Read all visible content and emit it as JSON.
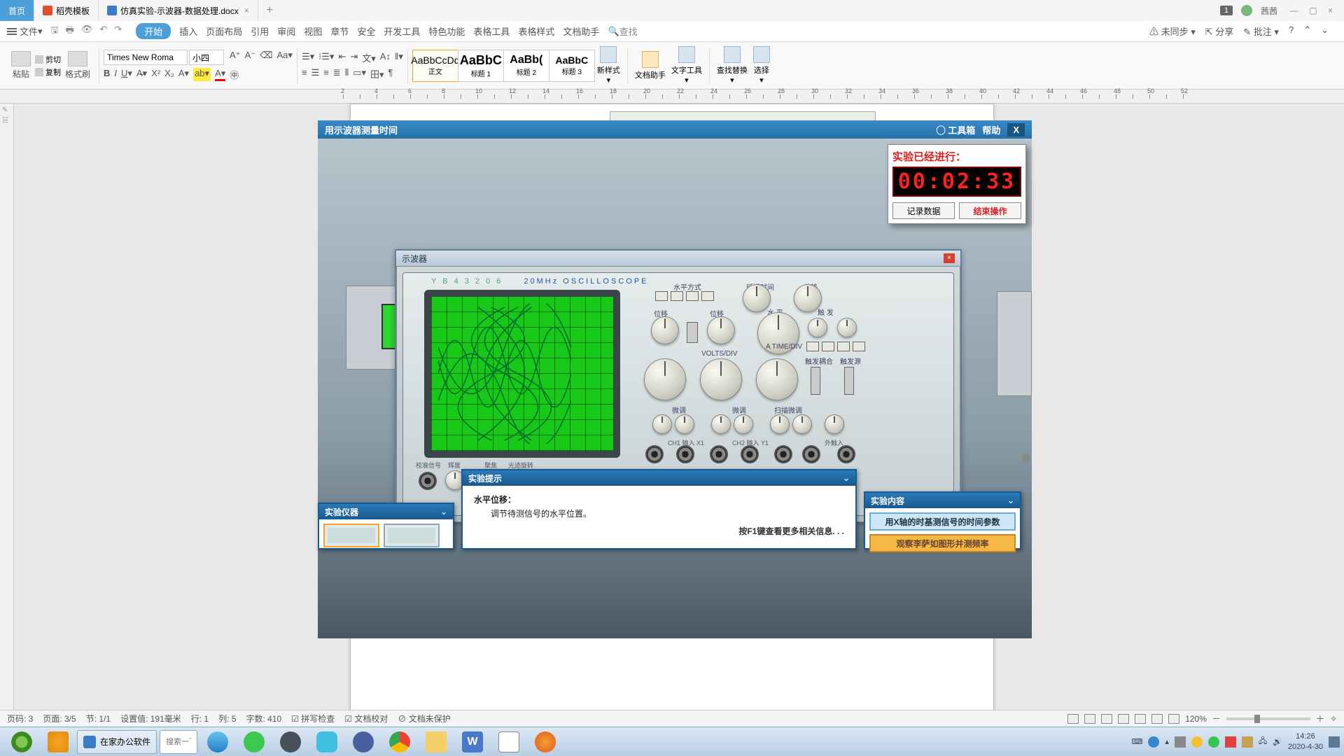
{
  "titlebar": {
    "home": "首页",
    "tab1": "稻壳模板",
    "tab2": "仿真实验-示波器-数据处理.docx",
    "user": "茜茜",
    "badge": "1"
  },
  "menubar": {
    "file": "文件",
    "start": "开始",
    "items": [
      "插入",
      "页面布局",
      "引用",
      "审阅",
      "视图",
      "章节",
      "安全",
      "开发工具",
      "特色功能",
      "表格工具",
      "表格样式",
      "文档助手"
    ],
    "search": "查找",
    "right": [
      "未同步",
      "分享",
      "批注"
    ]
  },
  "ribbon": {
    "paste": "粘贴",
    "cut": "剪切",
    "copy": "复制",
    "format": "格式刷",
    "font_name": "Times New Roma",
    "font_size": "小四",
    "styles": [
      {
        "preview": "AaBbCcDd",
        "name": "正文"
      },
      {
        "preview": "AaBbC",
        "name": "标题 1"
      },
      {
        "preview": "AaBb(",
        "name": "标题 2"
      },
      {
        "preview": "AaBbC",
        "name": "标题 3"
      }
    ],
    "new_style": "新样式",
    "doc_assist": "文档助手",
    "text_tool": "文字工具",
    "find_replace": "查找替换",
    "select": "选择"
  },
  "sim": {
    "title": "用示波器测量时间",
    "toolbox": "工具箱",
    "help": "帮助",
    "close": "X",
    "timer_title": "实验已经进行：",
    "timer_value": "00:02:33",
    "record": "记录数据",
    "end": "结束操作",
    "osc_title": "示波器",
    "osc_model": "Y B 4 3 2 0 6",
    "osc_spec": "20MHz   OSCILLOSCOPE",
    "labels": {
      "horiz_mode": "水平方式",
      "delay": "延迟时间",
      "position": "位移",
      "position2": "位移",
      "trigger": "触 发",
      "level": "水 平",
      "volts": "VOLTS/DIV",
      "time": "A TIME/DIV",
      "fine1": "微调",
      "fine2": "微调",
      "sweep_fine": "扫描微调",
      "cal": "校准信号",
      "bright": "辉度",
      "focus": "聚焦",
      "trace": "光迹旋转",
      "trig_coup": "触发耦合",
      "trig_src": "触发源",
      "ch1_in": "CH1 输入 X1",
      "ch2_in": "CH2 输入 Y1",
      "ext_in": "外触入"
    },
    "hint_panel": "实验提示",
    "hint_title": "水平位移：",
    "hint_text": "调节待测信号的水平位置。",
    "hint_more": "按F1键查看更多相关信息. . .",
    "inst_panel": "实验仪器",
    "cont_panel": "实验内容",
    "cont_b1": "用X轴的时基测信号的时间参数",
    "cont_b2": "观察李萨如图形并测频率"
  },
  "statusbar": {
    "items": [
      "页码: 3",
      "页面: 3/5",
      "节: 1/1",
      "设置值: 191毫米",
      "行: 1",
      "列: 5",
      "字数: 410",
      "拼写检查",
      "文档校对",
      "文档未保护"
    ],
    "zoom": "120%"
  },
  "taskbar": {
    "task1": "在家办公软件",
    "search_placeholder": "搜索一下",
    "time": "14:26",
    "date": "2020-4-30"
  }
}
